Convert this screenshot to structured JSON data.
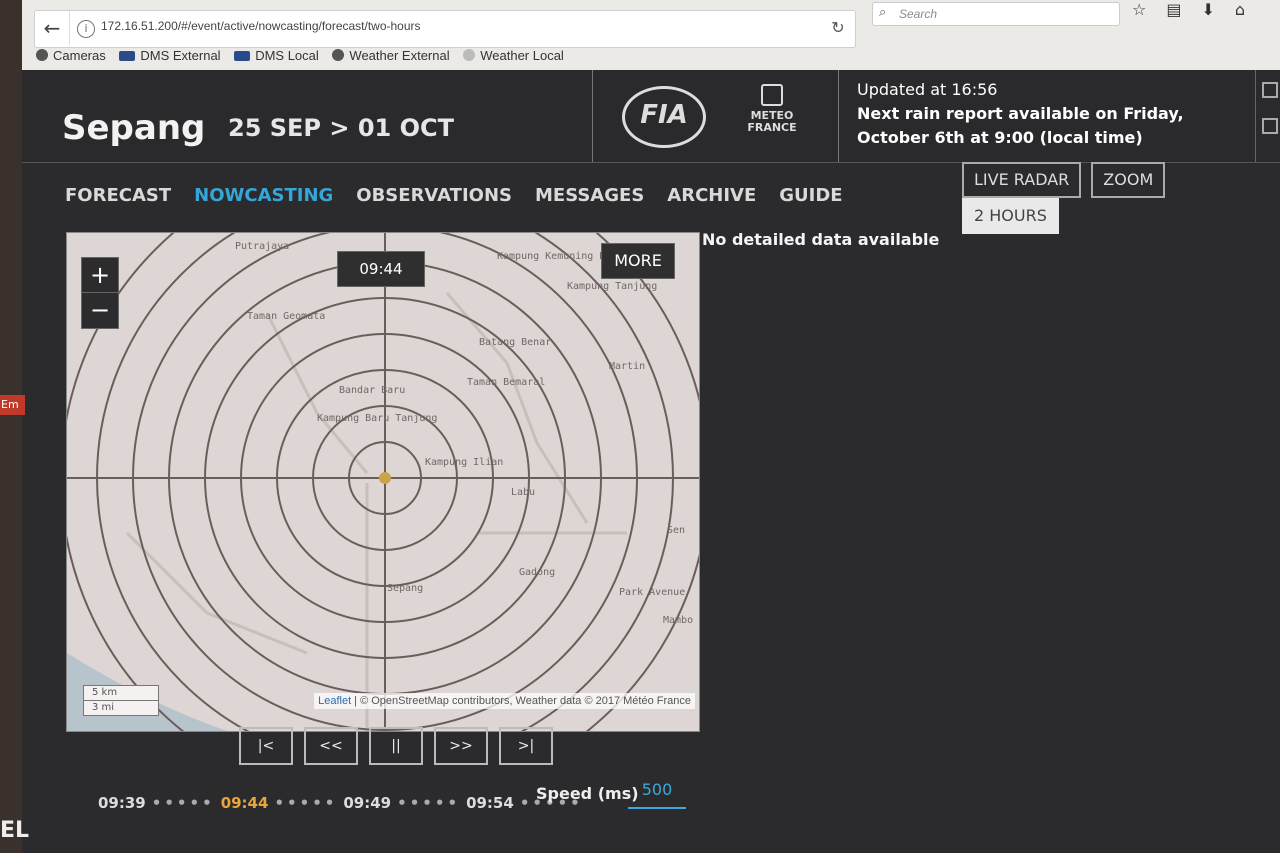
{
  "browser": {
    "url": "172.16.51.200/#/event/active/nowcasting/forecast/two-hours",
    "search_placeholder": "Search",
    "bookmarks": [
      "Cameras",
      "DMS External",
      "DMS Local",
      "Weather External",
      "Weather Local"
    ]
  },
  "header": {
    "brand": "Sepang",
    "dates": "25 SEP > 01 OCT",
    "fia_logo": "FIA",
    "meteo_logo_line1": "METEO",
    "meteo_logo_line2": "FRANCE",
    "updated": "Updated at 16:56",
    "next_report_line1": "Next rain report available on Friday,",
    "next_report_line2": "October 6th at 9:00 (local time)"
  },
  "nav": {
    "items": [
      "FORECAST",
      "NOWCASTING",
      "OBSERVATIONS",
      "MESSAGES",
      "ARCHIVE",
      "GUIDE"
    ],
    "active": "NOWCASTING"
  },
  "modes": [
    "LIVE RADAR",
    "ZOOM",
    "2 HOURS"
  ],
  "map": {
    "zoom_in": "+",
    "zoom_out": "−",
    "time": "09:44",
    "more": "MORE",
    "scale_km": "5 km",
    "scale_mi": "3 mi",
    "attribution_link": "Leaflet",
    "attribution_text": " | © OpenStreetMap contributors, Weather data © 2017 Météo France",
    "places": [
      "Putrajaya",
      "Kampung Kemuning Hulu",
      "Kampung Tanjung",
      "Taman Geomata",
      "Batang Benar",
      "Bandar Baru",
      "Taman Bemaral",
      "Kampung Baru Tanjung",
      "Kampung Ilian",
      "Labu",
      "Gadong",
      "Sepang",
      "Park Avenue",
      "Martin",
      "Sen",
      "Mambo"
    ]
  },
  "no_data": "No detailed data available",
  "controls": [
    "|<",
    "<<",
    "||",
    ">>",
    ">|"
  ],
  "timeline": {
    "times": [
      "09:39",
      "09:44",
      "09:49",
      "09:54"
    ],
    "current": "09:44",
    "speed_label": "Speed (ms)",
    "speed_value": "500"
  }
}
